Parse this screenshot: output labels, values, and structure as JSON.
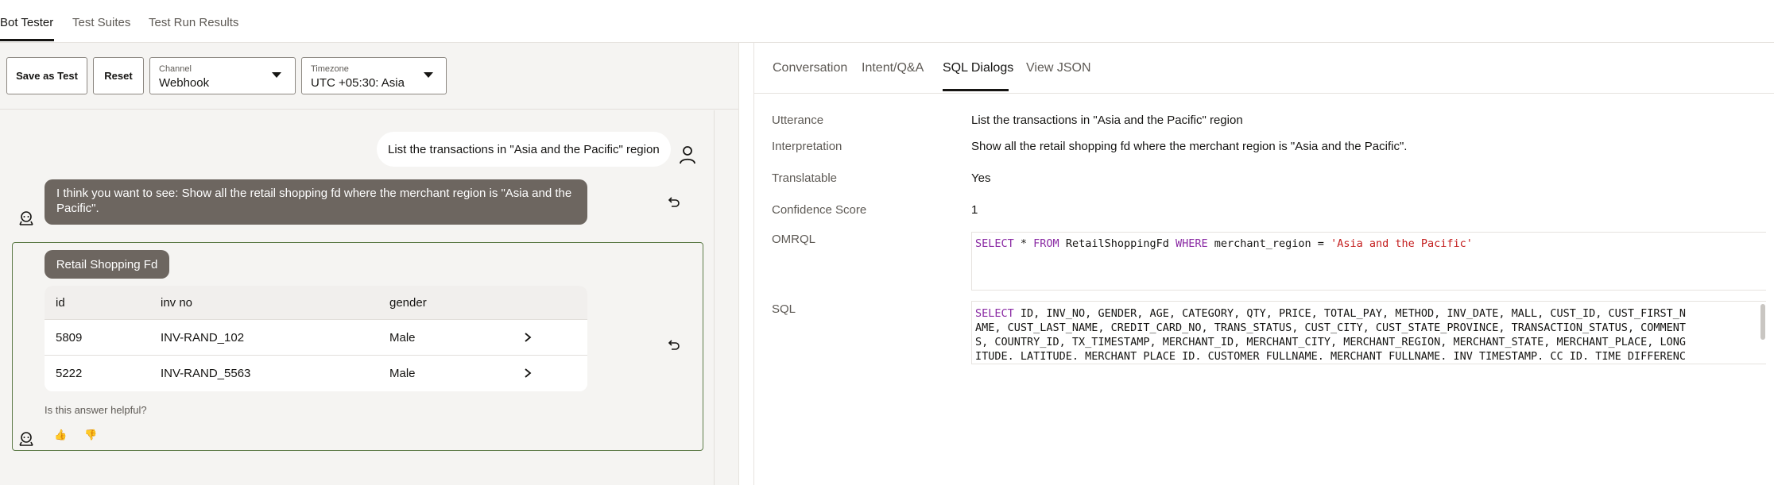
{
  "top_tabs": [
    {
      "label": "Bot Tester"
    },
    {
      "label": "Test Suites"
    },
    {
      "label": "Test Run Results"
    }
  ],
  "toolbar": {
    "save_label": "Save as Test",
    "reset_label": "Reset",
    "channel": {
      "label": "Channel",
      "value": "Webhook"
    },
    "timezone": {
      "label": "Timezone",
      "value": "UTC +05:30: Asia"
    }
  },
  "conversation": {
    "user_message": "List the transactions in \"Asia and the Pacific\" region",
    "bot_message": "I think you want to see: Show all the retail shopping fd where the merchant region is \"Asia and the Pacific\".",
    "card_title": "Retail Shopping Fd",
    "table": {
      "headers": [
        "id",
        "inv no",
        "gender"
      ],
      "rows": [
        [
          "5809",
          "INV-RAND_102",
          "Male"
        ],
        [
          "5222",
          "INV-RAND_5563",
          "Male"
        ]
      ]
    },
    "helpful_prompt": "Is this answer helpful?",
    "thumbs_up": "👍",
    "thumbs_down": "👎"
  },
  "right_tabs": [
    {
      "label": "Conversation"
    },
    {
      "label": "Intent/Q&A"
    },
    {
      "label": "SQL Dialogs"
    },
    {
      "label": "View JSON"
    }
  ],
  "sql_dialogs": {
    "utterance_label": "Utterance",
    "utterance": "List the transactions in \"Asia and the Pacific\" region",
    "interpretation_label": "Interpretation",
    "interpretation": "Show all the retail shopping fd where the merchant region is \"Asia and the Pacific\".",
    "translatable_label": "Translatable",
    "translatable": "Yes",
    "confidence_label": "Confidence Score",
    "confidence": "1",
    "omrql_label": "OMRQL",
    "omrql": {
      "kw1": "SELECT",
      "mid1": " * ",
      "kw2": "FROM",
      "mid2": " RetailShoppingFd ",
      "kw3": "WHERE",
      "mid3": " merchant_region = ",
      "str": "'Asia and the Pacific'"
    },
    "sql_label": "SQL",
    "sql": {
      "kw": "SELECT",
      "line1": " ID, INV_NO, GENDER, AGE, CATEGORY, QTY, PRICE, TOTAL_PAY, METHOD, INV_DATE, MALL, CUST_ID, CUST_FIRST_N",
      "line2": "AME, CUST_LAST_NAME, CREDIT_CARD_NO, TRANS_STATUS, CUST_CITY, CUST_STATE_PROVINCE, TRANSACTION_STATUS, COMMENT",
      "line3": "S, COUNTRY_ID, TX_TIMESTAMP, MERCHANT_ID, MERCHANT_CITY, MERCHANT_REGION, MERCHANT_STATE, MERCHANT_PLACE, LONG",
      "line4": "ITUDE. LATITUDE. MERCHANT PLACE ID. CUSTOMER FULLNAME. MERCHANT FULLNAME. INV TIMESTAMP. CC ID. TIME DIFFERENC"
    }
  }
}
